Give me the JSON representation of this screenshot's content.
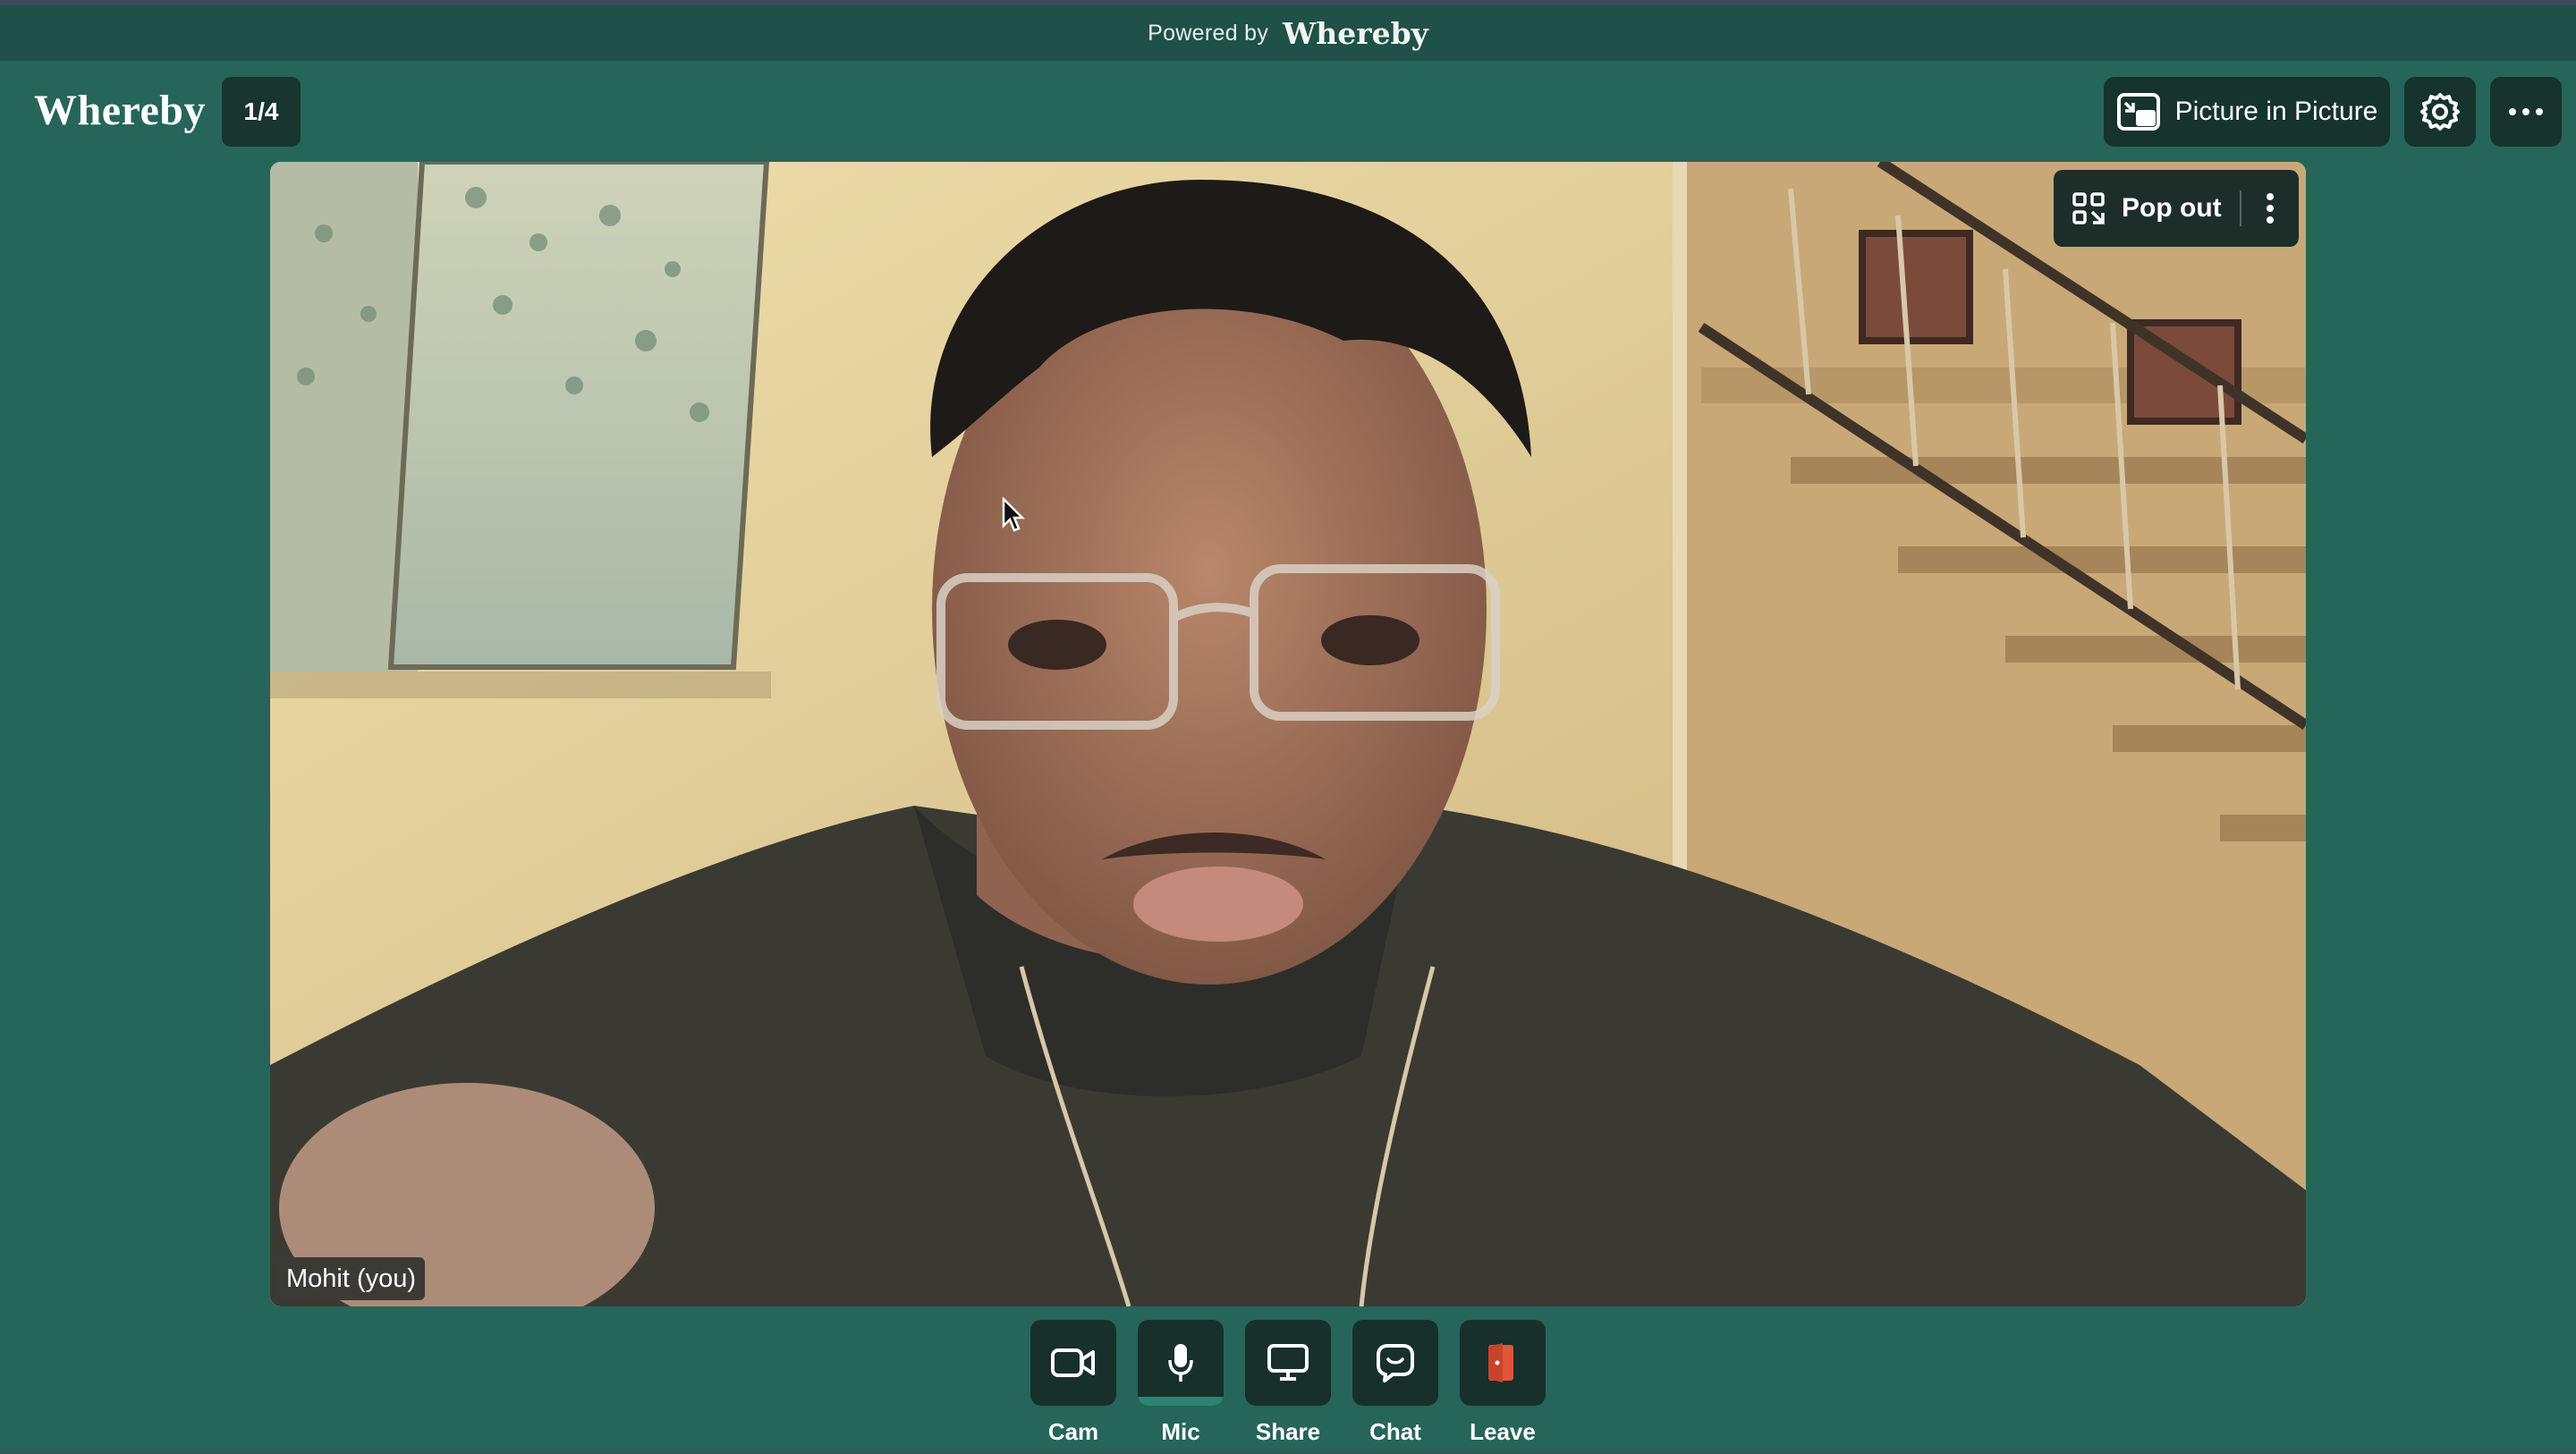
{
  "banner": {
    "powered_by": "Powered by",
    "brand": "Whereby"
  },
  "header": {
    "logo": "Whereby",
    "page_indicator": "1/4",
    "pip_label": "Picture in Picture",
    "settings_icon": "gear-icon",
    "more_icon": "more-horizontal-icon"
  },
  "video": {
    "participant_name": "Mohit (you)",
    "popout_label": "Pop out",
    "popout_icon": "popout-icon",
    "menu_icon": "more-vertical-icon"
  },
  "controls": [
    {
      "key": "cam",
      "label": "Cam",
      "icon": "camera-icon"
    },
    {
      "key": "mic",
      "label": "Mic",
      "icon": "microphone-icon"
    },
    {
      "key": "share",
      "label": "Share",
      "icon": "screen-share-icon"
    },
    {
      "key": "chat",
      "label": "Chat",
      "icon": "chat-icon"
    },
    {
      "key": "leave",
      "label": "Leave",
      "icon": "leave-door-icon"
    }
  ],
  "colors": {
    "background": "#26655a",
    "banner": "#1f5148",
    "button": "#16332d",
    "leave_accent": "#e2553b",
    "mic_active": "#2f8373"
  }
}
